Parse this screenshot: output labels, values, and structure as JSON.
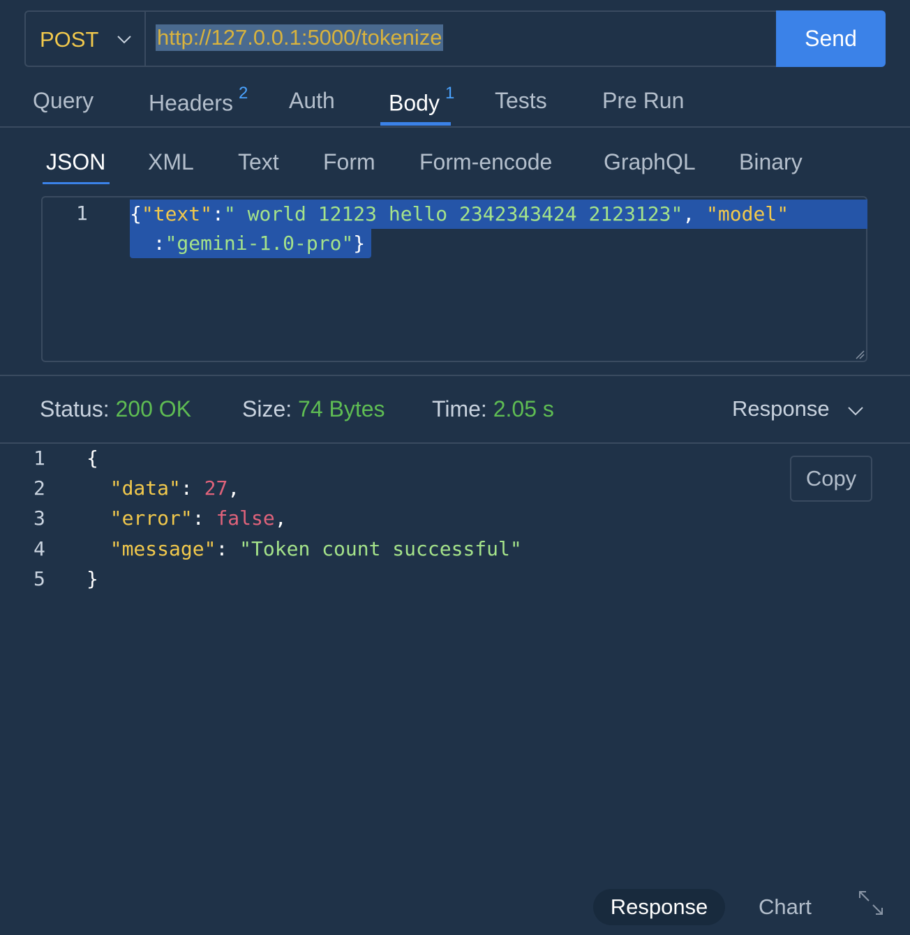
{
  "request": {
    "method": "POST",
    "url": "http://127.0.0.1:5000/tokenize",
    "send_label": "Send"
  },
  "request_tabs": [
    {
      "label": "Query",
      "badge": ""
    },
    {
      "label": "Headers",
      "badge": "2"
    },
    {
      "label": "Auth",
      "badge": ""
    },
    {
      "label": "Body",
      "badge": "1",
      "active": true
    },
    {
      "label": "Tests",
      "badge": ""
    },
    {
      "label": "Pre Run",
      "badge": ""
    }
  ],
  "body_tabs": [
    {
      "label": "JSON",
      "active": true
    },
    {
      "label": "XML"
    },
    {
      "label": "Text"
    },
    {
      "label": "Form"
    },
    {
      "label": "Form-encode"
    },
    {
      "label": "GraphQL"
    },
    {
      "label": "Binary"
    }
  ],
  "editor": {
    "line_number": "1",
    "line1_key1": "\"text\"",
    "line1_val1": "\" world 12123 hello 2342343424 2123123\"",
    "line1_key2": "\"model\"",
    "line2_val2": "\"gemini-1.0-pro\""
  },
  "status": {
    "status_label": "Status:",
    "status_value": "200 OK",
    "size_label": "Size:",
    "size_value": "74 Bytes",
    "time_label": "Time:",
    "time_value": "2.05 s",
    "view_select": "Response"
  },
  "response": {
    "line_numbers": [
      "1",
      "2",
      "3",
      "4",
      "5"
    ],
    "open_brace": "{",
    "close_brace": "}",
    "data_key": "\"data\"",
    "data_value": "27",
    "error_key": "\"error\"",
    "error_value": "false",
    "message_key": "\"message\"",
    "message_value": "\"Token count successful\"",
    "copy_label": "Copy"
  },
  "bottom_bar": {
    "response_label": "Response",
    "chart_label": "Chart"
  },
  "colors": {
    "background": "#1f3248",
    "accent": "#3b82e8",
    "method": "#f2c94c",
    "status_ok": "#5fbd53"
  },
  "icons": {
    "method_dropdown": "chevron-down-icon",
    "view_dropdown": "chevron-down-icon",
    "expand": "expand-icon"
  }
}
